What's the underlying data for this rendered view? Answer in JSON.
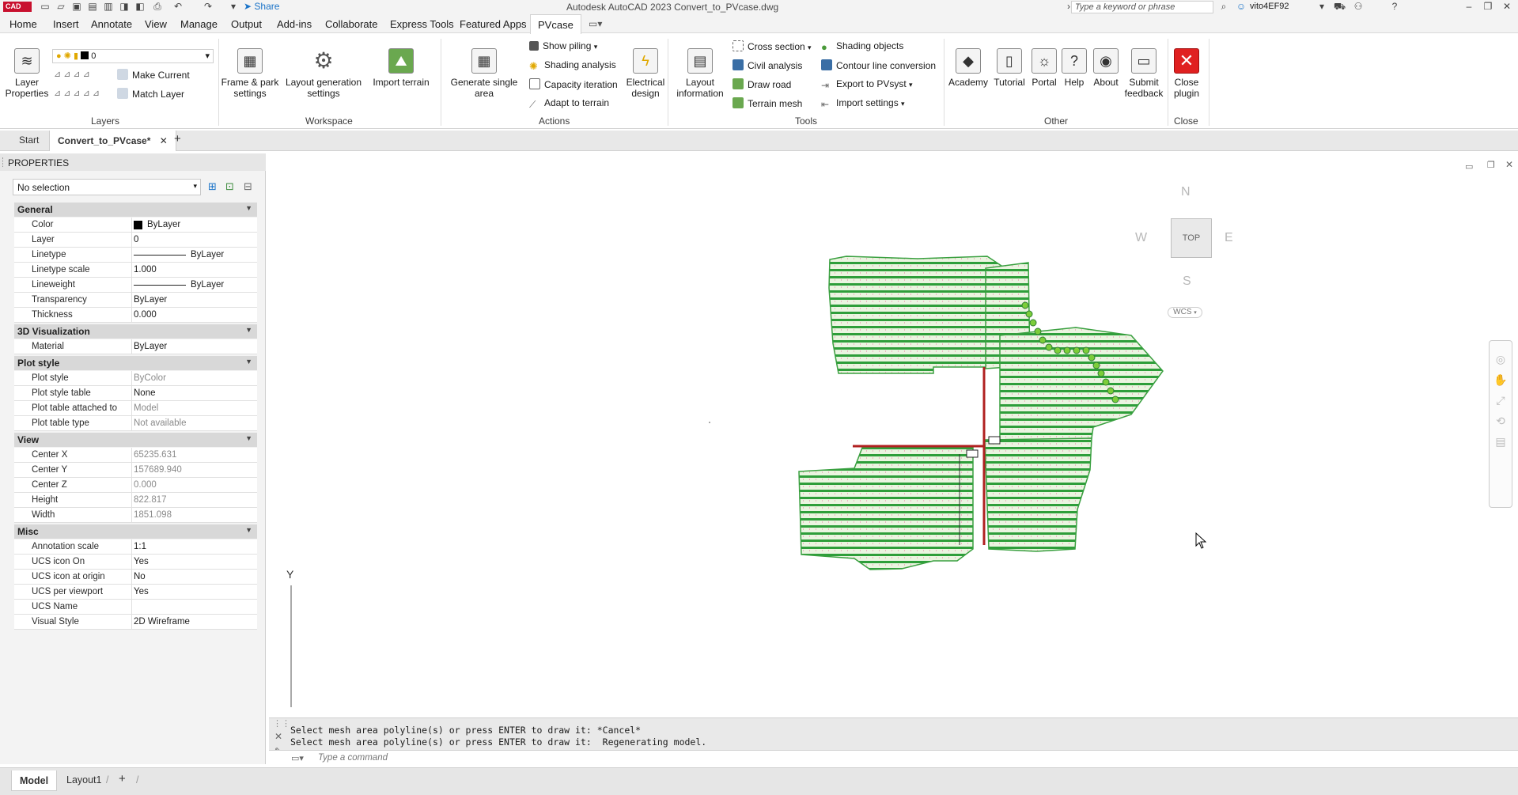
{
  "title_bar": {
    "app_badge": "CAD",
    "share_label": "Share",
    "window_title": "Autodesk AutoCAD 2023    Convert_to_PVcase.dwg",
    "search_placeholder": "Type a keyword or phrase",
    "username": "vito4EF92"
  },
  "menu_tabs": [
    "Home",
    "Insert",
    "Annotate",
    "View",
    "Manage",
    "Output",
    "Add-ins",
    "Collaborate",
    "Express Tools",
    "Featured Apps",
    "PVcase"
  ],
  "active_menu_tab": "PVcase",
  "ribbon": {
    "layers": {
      "layer_properties": "Layer Properties",
      "layer_value": "0",
      "make_current": "Make Current",
      "match_layer": "Match Layer",
      "panel_label": "Layers"
    },
    "workspace": {
      "frame_park": "Frame & park settings",
      "layout_generation": "Layout generation settings",
      "import_terrain": "Import terrain",
      "panel_label": "Workspace"
    },
    "actions": {
      "generate_single_area": "Generate single area",
      "show_piling": "Show piling",
      "shading_analysis": "Shading analysis",
      "capacity_iteration": "Capacity iteration",
      "adapt_to_terrain": "Adapt to terrain",
      "electrical_design": "Electrical design",
      "panel_label": "Actions"
    },
    "tools": {
      "layout_information": "Layout information",
      "cross_section": "Cross section",
      "civil_analysis": "Civil analysis",
      "draw_road": "Draw road",
      "terrain_mesh": "Terrain mesh",
      "shading_objects": "Shading objects",
      "contour_line_conversion": "Contour line conversion",
      "export_to_pvsyst": "Export to PVsyst",
      "import_settings": "Import settings",
      "panel_label": "Tools"
    },
    "other": {
      "academy": "Academy",
      "tutorial": "Tutorial",
      "portal": "Portal",
      "help": "Help",
      "about": "About",
      "submit_feedback": "Submit feedback",
      "panel_label": "Other"
    },
    "close": {
      "close_plugin": "Close plugin",
      "panel_label": "Close"
    }
  },
  "doc_tabs": {
    "start": "Start",
    "active": "Convert_to_PVcase*"
  },
  "properties": {
    "header": "PROPERTIES",
    "selection": "No selection",
    "sections": [
      {
        "title": "General",
        "rows": [
          {
            "label": "Color",
            "value": "ByLayer"
          },
          {
            "label": "Layer",
            "value": "0"
          },
          {
            "label": "Linetype",
            "value": "ByLayer"
          },
          {
            "label": "Linetype scale",
            "value": "1.000"
          },
          {
            "label": "Lineweight",
            "value": "ByLayer"
          },
          {
            "label": "Transparency",
            "value": "ByLayer"
          },
          {
            "label": "Thickness",
            "value": "0.000"
          }
        ]
      },
      {
        "title": "3D Visualization",
        "rows": [
          {
            "label": "Material",
            "value": "ByLayer"
          }
        ]
      },
      {
        "title": "Plot style",
        "rows": [
          {
            "label": "Plot style",
            "value": "ByColor"
          },
          {
            "label": "Plot style table",
            "value": "None"
          },
          {
            "label": "Plot table attached to",
            "value": "Model"
          },
          {
            "label": "Plot table type",
            "value": "Not available"
          }
        ]
      },
      {
        "title": "View",
        "rows": [
          {
            "label": "Center X",
            "value": "65235.631"
          },
          {
            "label": "Center Y",
            "value": "157689.940"
          },
          {
            "label": "Center Z",
            "value": "0.000"
          },
          {
            "label": "Height",
            "value": "822.817"
          },
          {
            "label": "Width",
            "value": "1851.098"
          }
        ]
      },
      {
        "title": "Misc",
        "rows": [
          {
            "label": "Annotation scale",
            "value": "1:1"
          },
          {
            "label": "UCS icon On",
            "value": "Yes"
          },
          {
            "label": "UCS icon at origin",
            "value": "No"
          },
          {
            "label": "UCS per viewport",
            "value": "Yes"
          },
          {
            "label": "UCS Name",
            "value": ""
          },
          {
            "label": "Visual Style",
            "value": "2D Wireframe"
          }
        ]
      }
    ]
  },
  "viewcube": {
    "north": "N",
    "south": "S",
    "east": "E",
    "west": "W",
    "top": "TOP",
    "wcs": "WCS"
  },
  "ucs_y_label": "Y",
  "command_line": {
    "line1": "Select mesh area polyline(s) or press ENTER to draw it: *Cancel*",
    "line2": "Select mesh area polyline(s) or press ENTER to draw it:  Regenerating model.",
    "placeholder": "Type a command"
  },
  "layout_tabs": [
    "Model",
    "Layout1"
  ],
  "colors": {
    "accent_red": "#c8102e",
    "pv_green": "#2e9e3a",
    "road_red": "#b02020",
    "close_red": "#e02020"
  }
}
